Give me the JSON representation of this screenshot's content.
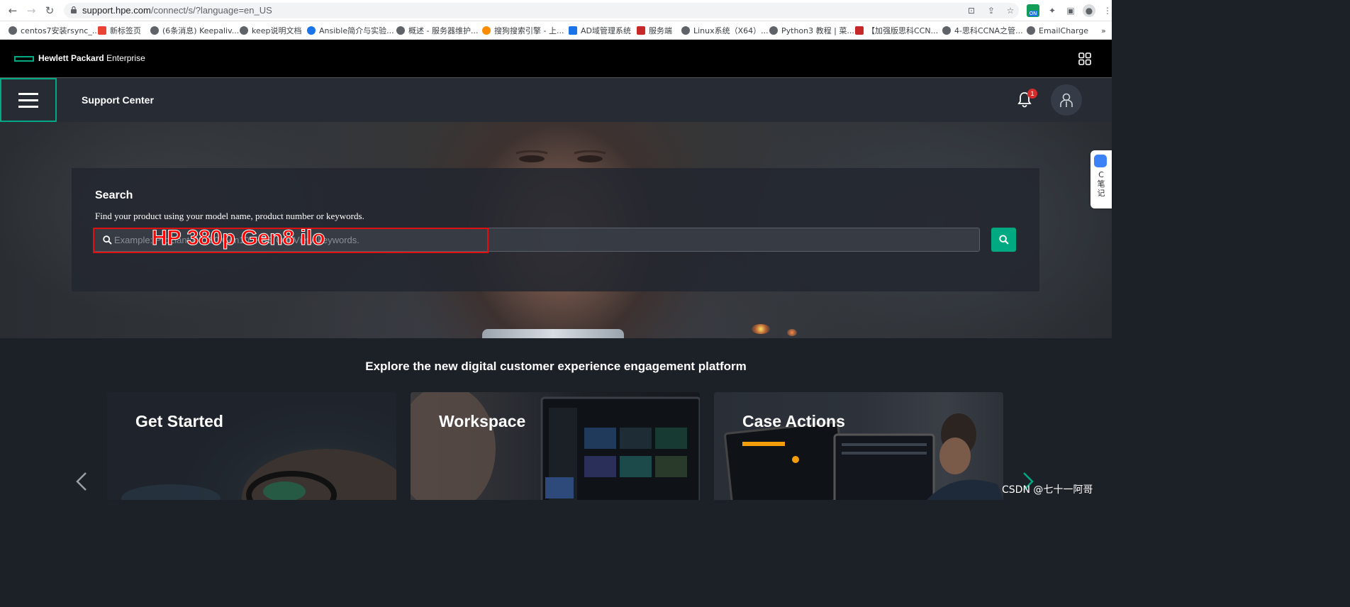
{
  "browser": {
    "url_host": "support.hpe.com",
    "url_path": "/connect/s/?language=en_US",
    "bookmarks": [
      {
        "label": "centos7安装rsync_...",
        "color": "#5f6368"
      },
      {
        "label": "新标签页",
        "color": "#ea4335"
      },
      {
        "label": "(6条消息) Keepaliv...",
        "color": "#5f6368"
      },
      {
        "label": "keep说明文档",
        "color": "#5f6368"
      },
      {
        "label": "Ansible简介与实验...",
        "color": "#1a73e8"
      },
      {
        "label": "概述 - 服务器维护...",
        "color": "#5f6368"
      },
      {
        "label": "搜狗搜索引擎 - 上...",
        "color": "#fb8c00"
      },
      {
        "label": "AD域管理系统",
        "color": "#1a73e8"
      },
      {
        "label": "服务端",
        "color": "#c62828"
      },
      {
        "label": "Linux系统（X64）...",
        "color": "#5f6368"
      },
      {
        "label": "Python3 教程 | 菜...",
        "color": "#5f6368"
      },
      {
        "label": "【加强版思科CCN...",
        "color": "#c62828"
      },
      {
        "label": "4-思科CCNA之管...",
        "color": "#5f6368"
      },
      {
        "label": "EmailCharge",
        "color": "#5f6368"
      }
    ],
    "ext_on_label": "ON"
  },
  "hpe": {
    "brand_bold": "Hewlett Packard",
    "brand_light": "Enterprise",
    "accent": "#01a982"
  },
  "support": {
    "title": "Support Center",
    "notification_count": "1"
  },
  "search": {
    "title": "Search",
    "subtitle": "Find your product using your model name, product number or keywords.",
    "placeholder": "Example: ProLiant DL380 Gen10, HPE OneView, keywords."
  },
  "annotation": {
    "text": "HP 380p Gen8 ilo",
    "color": "#ff0000"
  },
  "side_widget": {
    "text": "C笔记"
  },
  "explore": {
    "title": "Explore the new digital customer experience engagement platform",
    "cards": [
      {
        "title": "Get Started"
      },
      {
        "title": "Workspace"
      },
      {
        "title": "Case Actions"
      }
    ]
  },
  "watermark": "CSDN @七十一阿哥"
}
